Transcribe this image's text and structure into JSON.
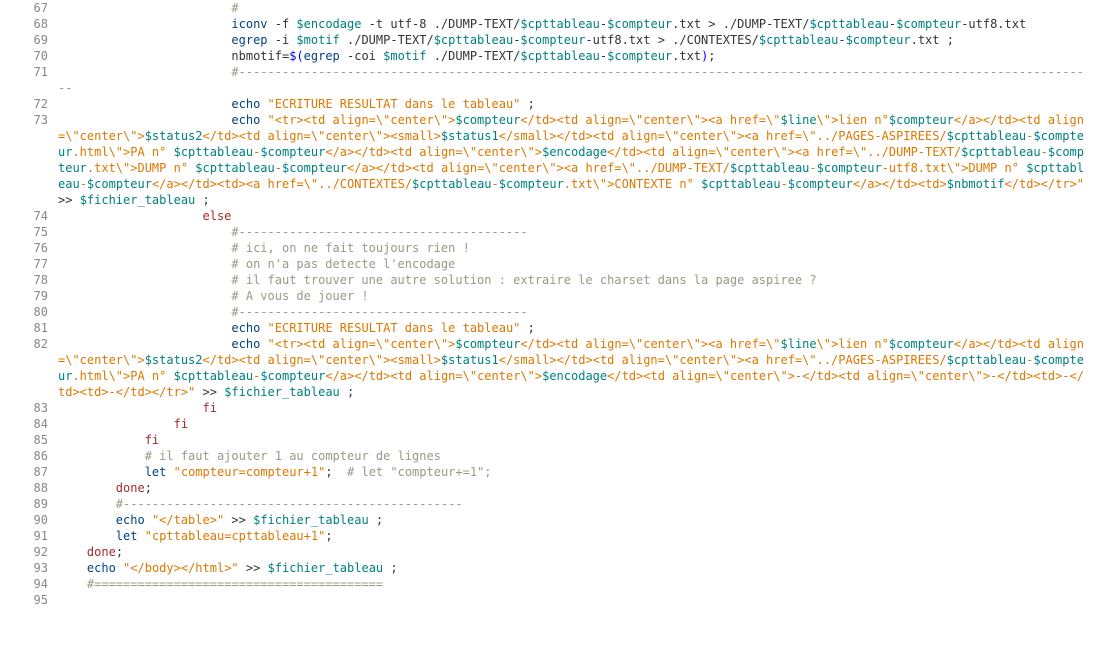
{
  "lines": [
    {
      "n": "67",
      "segs": [
        {
          "c": "txt",
          "t": "                        "
        },
        {
          "c": "cmt",
          "t": "#"
        }
      ]
    },
    {
      "n": "68",
      "segs": [
        {
          "c": "txt",
          "t": "                        "
        },
        {
          "c": "cmd",
          "t": "iconv"
        },
        {
          "c": "txt",
          "t": " -f "
        },
        {
          "c": "var",
          "t": "$encodage"
        },
        {
          "c": "txt",
          "t": " -t utf-8 ./DUMP-TEXT/"
        },
        {
          "c": "var",
          "t": "$cpttableau"
        },
        {
          "c": "txt",
          "t": "-"
        },
        {
          "c": "var",
          "t": "$compteur"
        },
        {
          "c": "txt",
          "t": ".txt > ./DUMP-TEXT/"
        },
        {
          "c": "var",
          "t": "$cpttableau"
        },
        {
          "c": "txt",
          "t": "-"
        },
        {
          "c": "var",
          "t": "$compteur"
        },
        {
          "c": "txt",
          "t": "-utf8.txt"
        }
      ]
    },
    {
      "n": "69",
      "segs": [
        {
          "c": "txt",
          "t": "                        "
        },
        {
          "c": "cmd",
          "t": "egrep"
        },
        {
          "c": "txt",
          "t": " -i "
        },
        {
          "c": "var",
          "t": "$motif"
        },
        {
          "c": "txt",
          "t": " ./DUMP-TEXT/"
        },
        {
          "c": "var",
          "t": "$cpttableau"
        },
        {
          "c": "txt",
          "t": "-"
        },
        {
          "c": "var",
          "t": "$compteur"
        },
        {
          "c": "txt",
          "t": "-utf8.txt > ./CONTEXTES/"
        },
        {
          "c": "var",
          "t": "$cpttableau"
        },
        {
          "c": "txt",
          "t": "-"
        },
        {
          "c": "var",
          "t": "$compteur"
        },
        {
          "c": "txt",
          "t": ".txt ;"
        }
      ]
    },
    {
      "n": "70",
      "segs": [
        {
          "c": "txt",
          "t": "                        "
        },
        {
          "c": "txt",
          "t": "nbmotif="
        },
        {
          "c": "k",
          "t": "$("
        },
        {
          "c": "cmd",
          "t": "egrep"
        },
        {
          "c": "txt",
          "t": " -coi "
        },
        {
          "c": "var",
          "t": "$motif"
        },
        {
          "c": "txt",
          "t": " ./DUMP-TEXT/"
        },
        {
          "c": "var",
          "t": "$cpttableau"
        },
        {
          "c": "txt",
          "t": "-"
        },
        {
          "c": "var",
          "t": "$compteur"
        },
        {
          "c": "txt",
          "t": ".txt"
        },
        {
          "c": "k",
          "t": ")"
        },
        {
          "c": "txt",
          "t": ";"
        }
      ]
    },
    {
      "n": "71",
      "segs": [
        {
          "c": "txt",
          "t": "                        "
        },
        {
          "c": "cmt",
          "t": "#-----------------------------------------------------------------------------------------------------------------------"
        }
      ]
    },
    {
      "n": "72",
      "segs": [
        {
          "c": "txt",
          "t": "                        "
        },
        {
          "c": "cmd",
          "t": "echo"
        },
        {
          "c": "txt",
          "t": " "
        },
        {
          "c": "str",
          "t": "\"ECRITURE RESULTAT dans le tableau\""
        },
        {
          "c": "txt",
          "t": " ;"
        }
      ]
    },
    {
      "n": "73",
      "segs": [
        {
          "c": "txt",
          "t": "                        "
        },
        {
          "c": "cmd",
          "t": "echo"
        },
        {
          "c": "txt",
          "t": " "
        },
        {
          "c": "str",
          "t": "\"<tr><td align=\\\"center\\\">"
        },
        {
          "c": "var",
          "t": "$compteur"
        },
        {
          "c": "str",
          "t": "</td><td align=\\\"center\\\"><a href=\\\""
        },
        {
          "c": "var",
          "t": "$line"
        },
        {
          "c": "str",
          "t": "\\\">lien n°"
        },
        {
          "c": "var",
          "t": "$compteur"
        },
        {
          "c": "str",
          "t": "</a></td><td align=\\\"center\\\">"
        },
        {
          "c": "var",
          "t": "$status2"
        },
        {
          "c": "str",
          "t": "</td><td align=\\\"center\\\"><small>"
        },
        {
          "c": "var",
          "t": "$status1"
        },
        {
          "c": "str",
          "t": "</small></td><td align=\\\"center\\\"><a href=\\\"../PAGES-ASPIREES/"
        },
        {
          "c": "var",
          "t": "$cpttableau"
        },
        {
          "c": "str",
          "t": "-"
        },
        {
          "c": "var",
          "t": "$compteur"
        },
        {
          "c": "str",
          "t": ".html\\\">PA n° "
        },
        {
          "c": "var",
          "t": "$cpttableau"
        },
        {
          "c": "str",
          "t": "-"
        },
        {
          "c": "var",
          "t": "$compteur"
        },
        {
          "c": "str",
          "t": "</a></td><td align=\\\"center\\\">"
        },
        {
          "c": "var",
          "t": "$encodage"
        },
        {
          "c": "str",
          "t": "</td><td align=\\\"center\\\"><a href=\\\"../DUMP-TEXT/"
        },
        {
          "c": "var",
          "t": "$cpttableau"
        },
        {
          "c": "str",
          "t": "-"
        },
        {
          "c": "var",
          "t": "$compteur"
        },
        {
          "c": "str",
          "t": ".txt\\\">DUMP n° "
        },
        {
          "c": "var",
          "t": "$cpttableau"
        },
        {
          "c": "str",
          "t": "-"
        },
        {
          "c": "var",
          "t": "$compteur"
        },
        {
          "c": "str",
          "t": "</a></td><td align=\\\"center\\\"><a href=\\\"../DUMP-TEXT/"
        },
        {
          "c": "var",
          "t": "$cpttableau"
        },
        {
          "c": "str",
          "t": "-"
        },
        {
          "c": "var",
          "t": "$compteur"
        },
        {
          "c": "str",
          "t": "-utf8.txt\\\">DUMP n° "
        },
        {
          "c": "var",
          "t": "$cpttableau"
        },
        {
          "c": "str",
          "t": "-"
        },
        {
          "c": "var",
          "t": "$compteur"
        },
        {
          "c": "str",
          "t": "</a></td><td><a href=\\\"../CONTEXTES/"
        },
        {
          "c": "var",
          "t": "$cpttableau"
        },
        {
          "c": "str",
          "t": "-"
        },
        {
          "c": "var",
          "t": "$compteur"
        },
        {
          "c": "str",
          "t": ".txt\\\">CONTEXTE n° "
        },
        {
          "c": "var",
          "t": "$cpttableau"
        },
        {
          "c": "str",
          "t": "-"
        },
        {
          "c": "var",
          "t": "$compteur"
        },
        {
          "c": "str",
          "t": "</a></td><td>"
        },
        {
          "c": "var",
          "t": "$nbmotif"
        },
        {
          "c": "str",
          "t": "</td></tr>\""
        },
        {
          "c": "txt",
          "t": " >> "
        },
        {
          "c": "var",
          "t": "$fichier_tableau"
        },
        {
          "c": "txt",
          "t": " ;"
        }
      ]
    },
    {
      "n": "74",
      "segs": [
        {
          "c": "txt",
          "t": "                    "
        },
        {
          "c": "kw",
          "t": "else"
        }
      ]
    },
    {
      "n": "75",
      "segs": [
        {
          "c": "txt",
          "t": "                        "
        },
        {
          "c": "cmt",
          "t": "#----------------------------------------"
        }
      ]
    },
    {
      "n": "76",
      "segs": [
        {
          "c": "txt",
          "t": "                        "
        },
        {
          "c": "cmt",
          "t": "# ici, on ne fait toujours rien !"
        }
      ]
    },
    {
      "n": "77",
      "segs": [
        {
          "c": "txt",
          "t": "                        "
        },
        {
          "c": "cmt",
          "t": "# on n'a pas detecte l'encodage"
        }
      ]
    },
    {
      "n": "78",
      "segs": [
        {
          "c": "txt",
          "t": "                        "
        },
        {
          "c": "cmt",
          "t": "# il faut trouver une autre solution : extraire le charset dans la page aspiree ?"
        }
      ]
    },
    {
      "n": "79",
      "segs": [
        {
          "c": "txt",
          "t": "                        "
        },
        {
          "c": "cmt",
          "t": "# A vous de jouer !"
        }
      ]
    },
    {
      "n": "80",
      "segs": [
        {
          "c": "txt",
          "t": "                        "
        },
        {
          "c": "cmt",
          "t": "#----------------------------------------"
        }
      ]
    },
    {
      "n": "81",
      "segs": [
        {
          "c": "txt",
          "t": "                        "
        },
        {
          "c": "cmd",
          "t": "echo"
        },
        {
          "c": "txt",
          "t": " "
        },
        {
          "c": "str",
          "t": "\"ECRITURE RESULTAT dans le tableau\""
        },
        {
          "c": "txt",
          "t": " ;"
        }
      ]
    },
    {
      "n": "82",
      "segs": [
        {
          "c": "txt",
          "t": "                        "
        },
        {
          "c": "cmd",
          "t": "echo"
        },
        {
          "c": "txt",
          "t": " "
        },
        {
          "c": "str",
          "t": "\"<tr><td align=\\\"center\\\">"
        },
        {
          "c": "var",
          "t": "$compteur"
        },
        {
          "c": "str",
          "t": "</td><td align=\\\"center\\\"><a href=\\\""
        },
        {
          "c": "var",
          "t": "$line"
        },
        {
          "c": "str",
          "t": "\\\">lien n°"
        },
        {
          "c": "var",
          "t": "$compteur"
        },
        {
          "c": "str",
          "t": "</a></td><td align=\\\"center\\\">"
        },
        {
          "c": "var",
          "t": "$status2"
        },
        {
          "c": "str",
          "t": "</td><td align=\\\"center\\\"><small>"
        },
        {
          "c": "var",
          "t": "$status1"
        },
        {
          "c": "str",
          "t": "</small></td><td align=\\\"center\\\"><a href=\\\"../PAGES-ASPIREES/"
        },
        {
          "c": "var",
          "t": "$cpttableau"
        },
        {
          "c": "str",
          "t": "-"
        },
        {
          "c": "var",
          "t": "$compteur"
        },
        {
          "c": "str",
          "t": ".html\\\">PA n° "
        },
        {
          "c": "var",
          "t": "$cpttableau"
        },
        {
          "c": "str",
          "t": "-"
        },
        {
          "c": "var",
          "t": "$compteur"
        },
        {
          "c": "str",
          "t": "</a></td><td align=\\\"center\\\">"
        },
        {
          "c": "var",
          "t": "$encodage"
        },
        {
          "c": "str",
          "t": "</td><td align=\\\"center\\\">-</td><td align=\\\"center\\\">-</td><td>-</td><td>-</td></tr>\""
        },
        {
          "c": "txt",
          "t": " >> "
        },
        {
          "c": "var",
          "t": "$fichier_tableau"
        },
        {
          "c": "txt",
          "t": " ;"
        }
      ]
    },
    {
      "n": "83",
      "segs": [
        {
          "c": "txt",
          "t": "                    "
        },
        {
          "c": "kw",
          "t": "fi"
        }
      ]
    },
    {
      "n": "84",
      "segs": [
        {
          "c": "txt",
          "t": "                "
        },
        {
          "c": "kw",
          "t": "fi"
        }
      ]
    },
    {
      "n": "85",
      "segs": [
        {
          "c": "txt",
          "t": "            "
        },
        {
          "c": "kw",
          "t": "fi"
        }
      ]
    },
    {
      "n": "86",
      "segs": [
        {
          "c": "txt",
          "t": "            "
        },
        {
          "c": "cmt",
          "t": "# il faut ajouter 1 au compteur de lignes"
        }
      ]
    },
    {
      "n": "87",
      "segs": [
        {
          "c": "txt",
          "t": "            "
        },
        {
          "c": "cmd",
          "t": "let"
        },
        {
          "c": "txt",
          "t": " "
        },
        {
          "c": "str",
          "t": "\"compteur=compteur+1\""
        },
        {
          "c": "txt",
          "t": ";  "
        },
        {
          "c": "cmt",
          "t": "# let \"compteur+=1\";"
        }
      ]
    },
    {
      "n": "88",
      "segs": [
        {
          "c": "txt",
          "t": "        "
        },
        {
          "c": "kw",
          "t": "done"
        },
        {
          "c": "txt",
          "t": ";"
        }
      ]
    },
    {
      "n": "89",
      "segs": [
        {
          "c": "txt",
          "t": "        "
        },
        {
          "c": "cmt",
          "t": "#-----------------------------------------------"
        }
      ]
    },
    {
      "n": "90",
      "segs": [
        {
          "c": "txt",
          "t": "        "
        },
        {
          "c": "cmd",
          "t": "echo"
        },
        {
          "c": "txt",
          "t": " "
        },
        {
          "c": "str",
          "t": "\"</table>\""
        },
        {
          "c": "txt",
          "t": " >> "
        },
        {
          "c": "var",
          "t": "$fichier_tableau"
        },
        {
          "c": "txt",
          "t": " ;"
        }
      ]
    },
    {
      "n": "91",
      "segs": [
        {
          "c": "txt",
          "t": "        "
        },
        {
          "c": "cmd",
          "t": "let"
        },
        {
          "c": "txt",
          "t": " "
        },
        {
          "c": "str",
          "t": "\"cpttableau=cpttableau+1\""
        },
        {
          "c": "txt",
          "t": ";"
        }
      ]
    },
    {
      "n": "92",
      "segs": [
        {
          "c": "txt",
          "t": "    "
        },
        {
          "c": "kw",
          "t": "done"
        },
        {
          "c": "txt",
          "t": ";"
        }
      ]
    },
    {
      "n": "93",
      "segs": [
        {
          "c": "txt",
          "t": "    "
        },
        {
          "c": "cmd",
          "t": "echo"
        },
        {
          "c": "txt",
          "t": " "
        },
        {
          "c": "str",
          "t": "\"</body></html>\""
        },
        {
          "c": "txt",
          "t": " >> "
        },
        {
          "c": "var",
          "t": "$fichier_tableau"
        },
        {
          "c": "txt",
          "t": " ;"
        }
      ]
    },
    {
      "n": "94",
      "segs": [
        {
          "c": "txt",
          "t": "    "
        },
        {
          "c": "cmt",
          "t": "#========================================"
        }
      ]
    },
    {
      "n": "95",
      "segs": [
        {
          "c": "txt",
          "t": ""
        }
      ]
    }
  ]
}
